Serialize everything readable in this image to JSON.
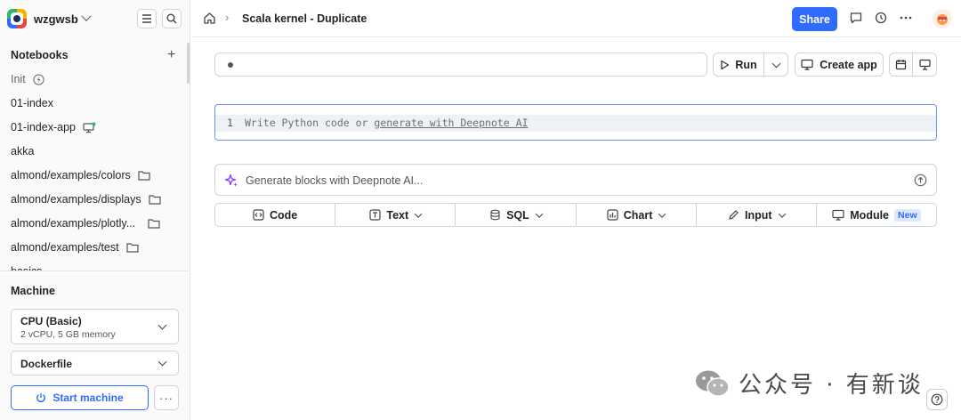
{
  "workspace": {
    "name": "wzgwsb"
  },
  "sidebar": {
    "notebooks_title": "Notebooks",
    "items": [
      {
        "label": "Init"
      },
      {
        "label": "01-index"
      },
      {
        "label": "01-index-app"
      },
      {
        "label": "akka"
      },
      {
        "label": "almond/examples/colors"
      },
      {
        "label": "almond/examples/displays"
      },
      {
        "label": "almond/examples/plotly..."
      },
      {
        "label": "almond/examples/test"
      },
      {
        "label": "basics"
      }
    ]
  },
  "machine": {
    "title": "Machine",
    "cpu_name": "CPU (Basic)",
    "cpu_spec": "2 vCPU, 5 GB memory",
    "environment": "Dockerfile",
    "start_label": "Start machine",
    "more_label": "···"
  },
  "topbar": {
    "breadcrumb_sep": "›",
    "title": "Scala kernel - Duplicate",
    "share_label": "Share"
  },
  "toolbar": {
    "run_label": "Run",
    "create_app_label": "Create app"
  },
  "cell": {
    "line_number": "1",
    "placeholder_prefix": "Write Python code or ",
    "placeholder_link": "generate with Deepnote AI"
  },
  "ai_bar": {
    "placeholder": "Generate blocks with Deepnote AI..."
  },
  "blocks": {
    "code": "Code",
    "text": "Text",
    "sql": "SQL",
    "chart": "Chart",
    "input": "Input",
    "module": "Module",
    "new_badge": "New"
  },
  "watermark": {
    "text": "公众号 · 有新谈"
  },
  "colors": {
    "accent": "#2f6bff",
    "focus": "#6b93ff"
  }
}
